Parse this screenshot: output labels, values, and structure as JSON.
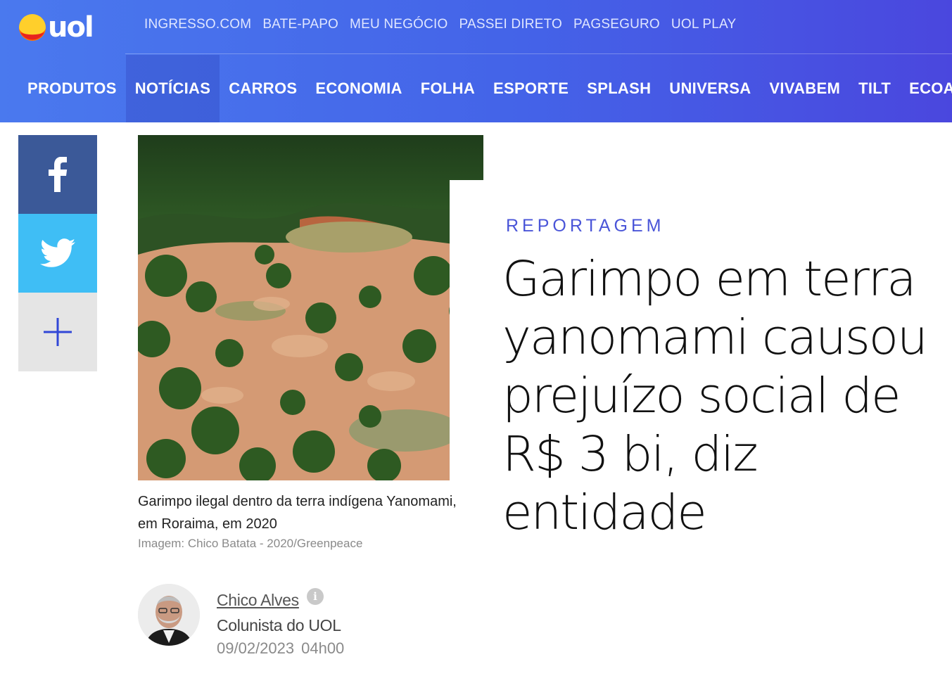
{
  "header": {
    "logo_text": "uol",
    "top_links": [
      "INGRESSO.COM",
      "BATE-PAPO",
      "MEU NEGÓCIO",
      "PASSEI DIRETO",
      "PAGSEGURO",
      "UOL PLAY"
    ],
    "main_nav": [
      "PRODUTOS",
      "NOTÍCIAS",
      "CARROS",
      "ECONOMIA",
      "FOLHA",
      "ESPORTE",
      "SPLASH",
      "UNIVERSA",
      "VIVABEM",
      "TILT",
      "ECOA"
    ],
    "active_nav": "NOTÍCIAS"
  },
  "share": {
    "facebook_icon": "facebook-icon",
    "twitter_icon": "twitter-icon",
    "more_icon": "plus-icon"
  },
  "figure": {
    "caption": "Garimpo ilegal dentro da terra indígena Yanomami, em Roraima, em 2020",
    "credit": "Imagem: Chico Batata - 2020/Greenpeace"
  },
  "article": {
    "kicker": "REPORTAGEM",
    "headline": "Garimpo em terra yanomami causou prejuízo social de R$ 3 bi, diz entidade"
  },
  "author": {
    "name": "Chico Alves",
    "role": "Colunista do UOL",
    "date": "09/02/2023",
    "time": "04h00",
    "info_icon_glyph": "i"
  },
  "colors": {
    "header_start": "#4a79ee",
    "header_end": "#4a47de",
    "kicker": "#4a55d8",
    "facebook": "#3b5998",
    "twitter": "#3fbef5",
    "share_more_bg": "#e5e5e5"
  }
}
